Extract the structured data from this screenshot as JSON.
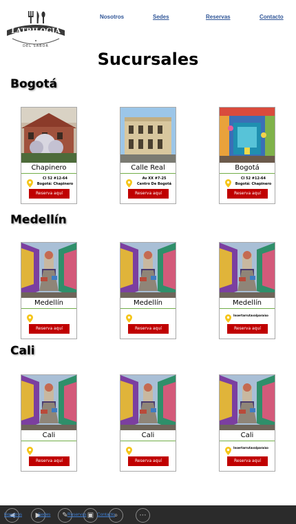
{
  "brand": {
    "name": "LATRILOGIA",
    "tagline": "DEL SABOR"
  },
  "nav": {
    "items": [
      "Nosotros",
      "Sedes",
      "Reservas",
      "Contacto"
    ]
  },
  "page_title": "Sucursales",
  "sections": [
    {
      "city": "Bogotá",
      "cards": [
        {
          "name": "Chapinero",
          "addr1": "Cl 52 #12-64",
          "addr2": "Bogotá: Chapinero",
          "button": "Reserva aquí",
          "photo": "house-with-tree"
        },
        {
          "name": "Calle Real",
          "addr1": "Av XX #7-25",
          "addr2": "Centro De Bogotá",
          "button": "Reserva aquí",
          "photo": "colonial-building"
        },
        {
          "name": "Bogotá",
          "addr1": "Cl 52 #12-64",
          "addr2": "Bogotá: Chapinero",
          "button": "Reserva aquí",
          "photo": "colorful-storefront"
        }
      ]
    },
    {
      "city": "Medellín",
      "cards": [
        {
          "name": "Medellín",
          "addr1": "",
          "addr2": "",
          "button": "Reserva aquí",
          "photo": "colorful-street"
        },
        {
          "name": "Medellín",
          "addr1": "",
          "addr2": "",
          "button": "Reserva aquí",
          "photo": "colorful-street"
        },
        {
          "name": "Medellín",
          "addr1": "Insertarrutavalparaíso",
          "addr2": "",
          "button": "Reserva aquí",
          "photo": "colorful-street"
        }
      ]
    },
    {
      "city": "Cali",
      "cards": [
        {
          "name": "Cali",
          "addr1": "",
          "addr2": "",
          "button": "Reserva aquí",
          "photo": "colorful-street"
        },
        {
          "name": "Cali",
          "addr1": "",
          "addr2": "",
          "button": "Reserva aquí",
          "photo": "colorful-street"
        },
        {
          "name": "Cali",
          "addr1": "Insertarrutavalparaíso",
          "addr2": "",
          "button": "Reserva aquí",
          "photo": "colorful-street"
        }
      ]
    }
  ],
  "taskbar": {
    "links": [
      "Nosotros",
      "Sedes",
      "Reservas",
      "Contacto"
    ],
    "icons": [
      "back-icon",
      "play-icon",
      "pen-icon",
      "window-icon",
      "zoom-icon",
      "more-icon"
    ]
  },
  "colors": {
    "nav_link": "#2f5597",
    "button": "#c00000",
    "pin": "#f5c518",
    "underline": "#70ad47",
    "taskbar": "#2b2b2b"
  }
}
